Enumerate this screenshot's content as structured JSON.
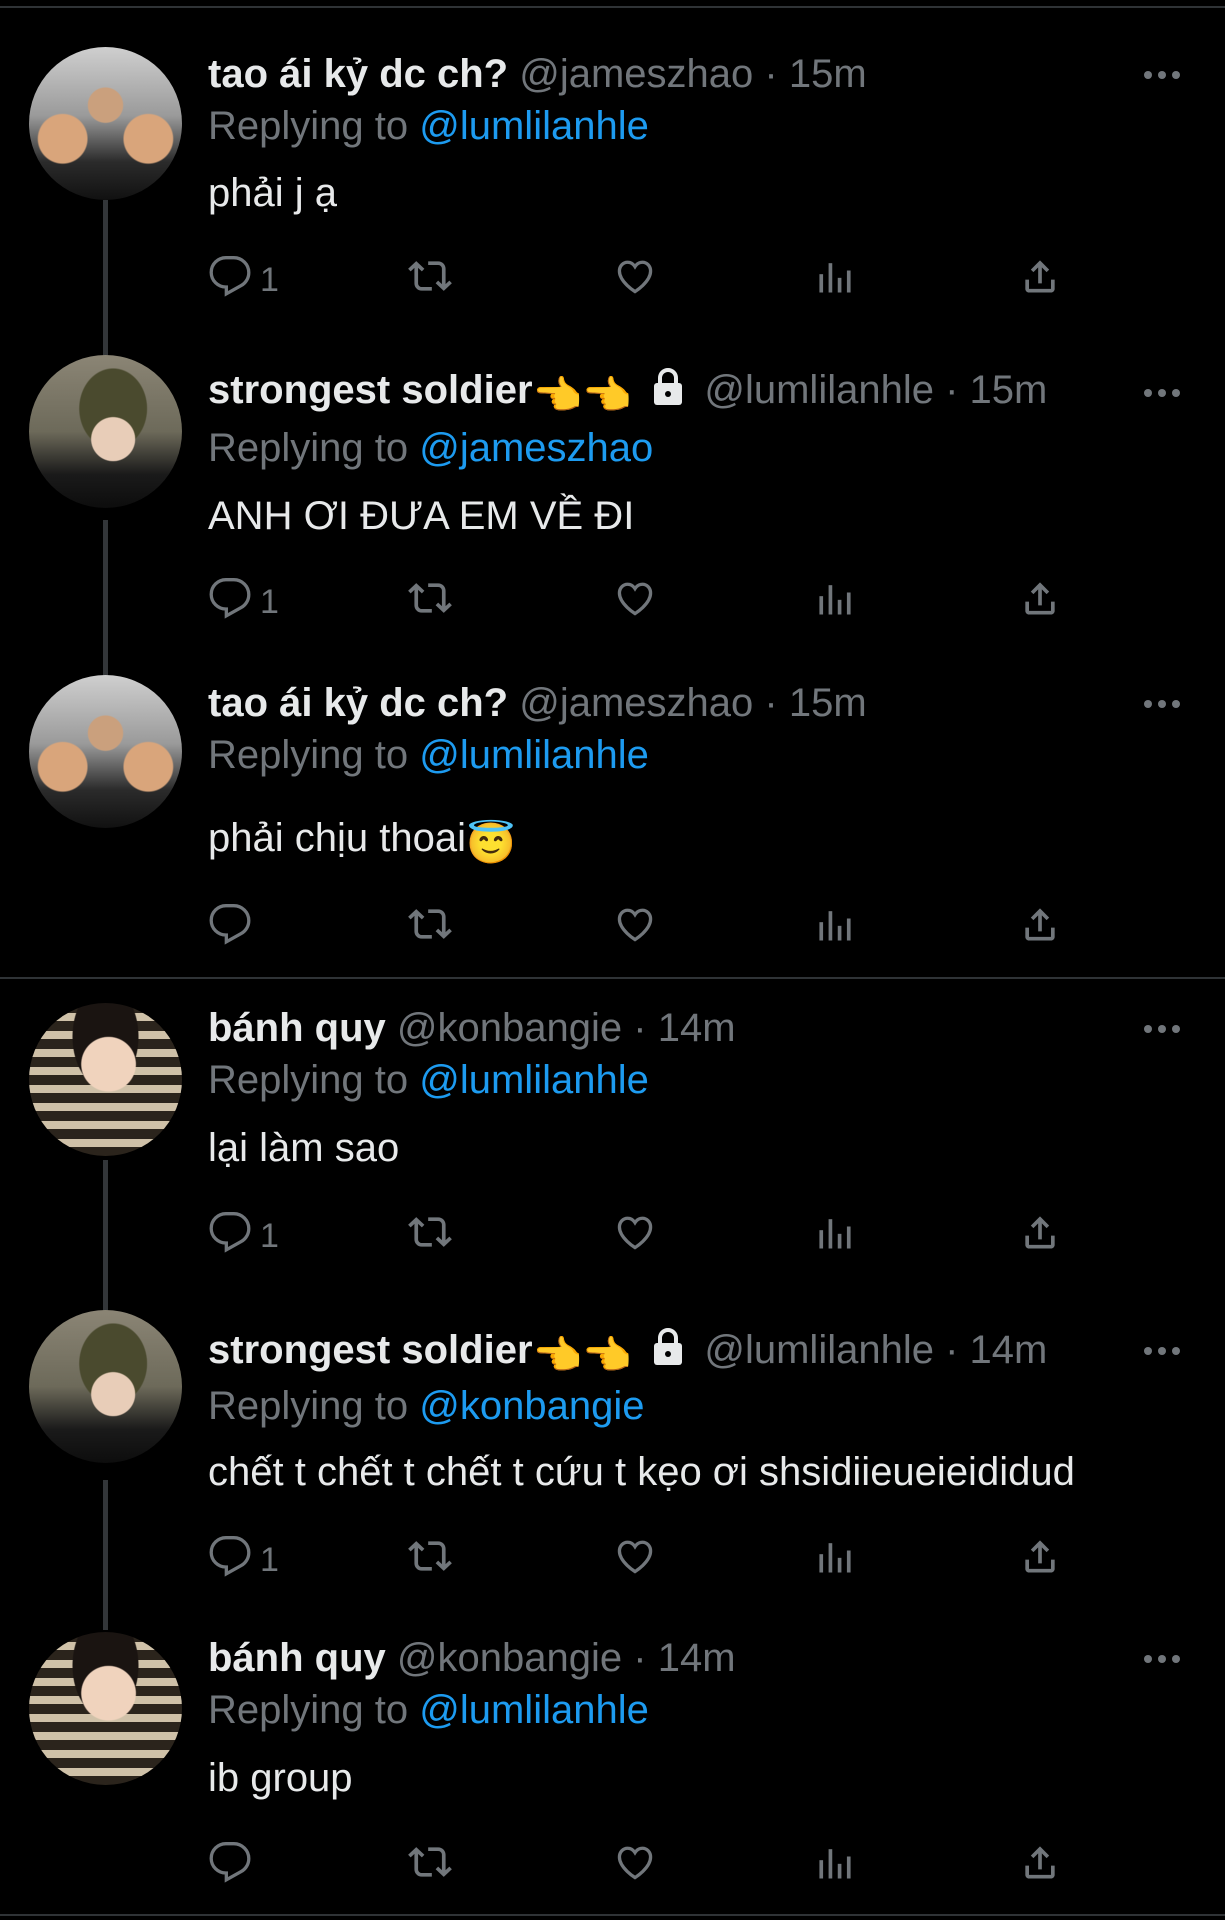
{
  "tweets": [
    {
      "name": "tao ái kỷ dc ch?",
      "handle": "@jameszhao",
      "time": "15m",
      "reply_label": "Replying to",
      "reply_to": "@lumlilanhle",
      "text": "phải j ạ",
      "reply_count": "1"
    },
    {
      "name": "strongest soldier",
      "name_emojis": "👈👈",
      "locked": true,
      "handle": "@lumlilanhle",
      "time": "15m",
      "reply_label": "Replying to",
      "reply_to": "@jameszhao",
      "text": "ANH ƠI ĐƯA EM VỀ ĐI",
      "reply_count": "1"
    },
    {
      "name": "tao ái kỷ dc ch?",
      "handle": "@jameszhao",
      "time": "15m",
      "reply_label": "Replying to",
      "reply_to": "@lumlilanhle",
      "text": "phải chịu thoai",
      "text_emoji": "😇",
      "reply_count": ""
    },
    {
      "name": "bánh quy",
      "handle": "@konbangie",
      "time": "14m",
      "reply_label": "Replying to",
      "reply_to": "@lumlilanhle",
      "text": "lại làm sao",
      "reply_count": "1"
    },
    {
      "name": "strongest soldier",
      "name_emojis": "👈👈",
      "locked": true,
      "handle": "@lumlilanhle",
      "time": "14m",
      "reply_label": "Replying to",
      "reply_to": "@konbangie",
      "text": "chết t chết t chết t cứu t kẹo ơi shsidiieueieididud",
      "reply_count": "1"
    },
    {
      "name": "bánh quy",
      "handle": "@konbangie",
      "time": "14m",
      "reply_label": "Replying to",
      "reply_to": "@lumlilanhle",
      "text": "ib group",
      "reply_count": ""
    }
  ],
  "separator": "·",
  "icons": {
    "reply": "reply-icon",
    "retweet": "retweet-icon",
    "like": "heart-icon",
    "analytics": "analytics-icon",
    "share": "share-icon",
    "more": "more-icon",
    "lock": "lock-icon"
  },
  "colors": {
    "background": "#000000",
    "text": "#e7e9ea",
    "muted": "#71767b",
    "link": "#1d9bf0"
  }
}
